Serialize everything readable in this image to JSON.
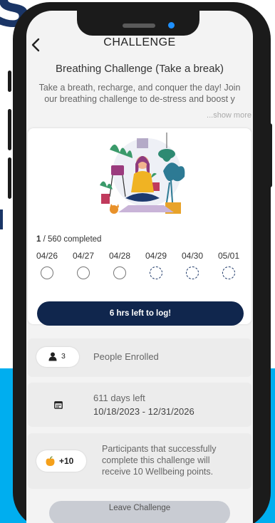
{
  "header": {
    "title": "CHALLENGE"
  },
  "challenge": {
    "title": "Breathing Challenge (Take a break)",
    "description_line1": "Take a breath, recharge, and conquer the day!  Join",
    "description_line2": "our breathing challenge to de-stress and boost y",
    "show_more": "...show more",
    "completed_count": "1",
    "completed_suffix": " / 560 completed",
    "days": [
      {
        "label": "04/26",
        "state": "open"
      },
      {
        "label": "04/27",
        "state": "open"
      },
      {
        "label": "04/28",
        "state": "open"
      },
      {
        "label": "04/29",
        "state": "future"
      },
      {
        "label": "04/30",
        "state": "future"
      },
      {
        "label": "05/01",
        "state": "future"
      }
    ],
    "log_button": "6 hrs left to log!"
  },
  "enrolled": {
    "count": "3",
    "label": "People Enrolled"
  },
  "duration": {
    "days_left": "611 days left",
    "range": "10/18/2023 - 12/31/2026"
  },
  "reward": {
    "points": "+10",
    "text_line1": "Participants that successfully",
    "text_line2": "complete this challenge will",
    "text_line3": "receive 10 Wellbeing points."
  },
  "leave": {
    "label": "Leave Challenge"
  },
  "colors": {
    "navy": "#10264d",
    "backdrop_blue": "#00aeef",
    "dashed": "#1a3566"
  }
}
